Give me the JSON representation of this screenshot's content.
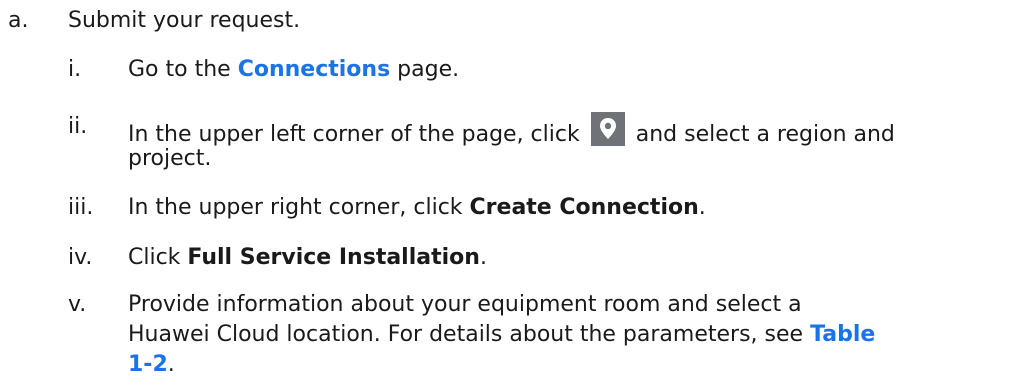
{
  "step": {
    "marker": "a.",
    "text": "Submit your request."
  },
  "substeps": [
    {
      "marker": "i.",
      "pre": "Go to the ",
      "link": "Connections",
      "post": " page."
    },
    {
      "marker": "ii.",
      "pre": "In the upper left corner of the page, click",
      "icon": "location-pin-icon",
      "post": "and select a region and",
      "line2": "project."
    },
    {
      "marker": "iii.",
      "pre": "In the upper right corner, click ",
      "bold": "Create Connection",
      "post": "."
    },
    {
      "marker": "iv.",
      "pre": "Click ",
      "bold": "Full Service Installation",
      "post": "."
    },
    {
      "marker": "v.",
      "line1": "Provide information about your equipment room and select a",
      "line2_pre": "Huawei Cloud location. For details about the parameters, see ",
      "link_part1": "Table",
      "link_part2": "1-2",
      "post": "."
    }
  ],
  "colors": {
    "link": "#1a73e8",
    "icon_bg": "#6f7378",
    "text": "#1a1a1a"
  }
}
